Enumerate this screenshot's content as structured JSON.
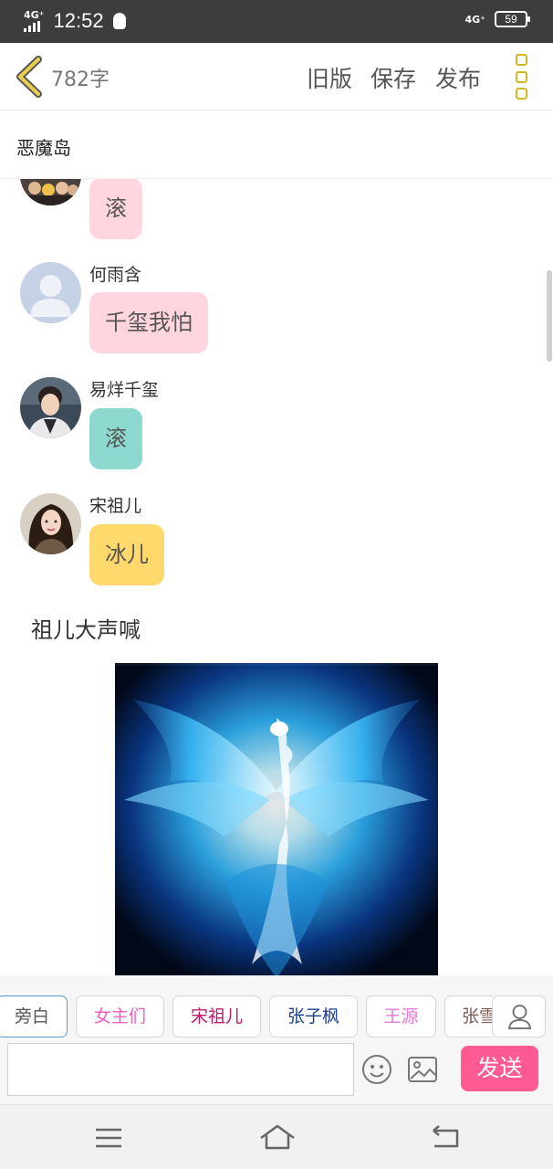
{
  "status_bar": {
    "network_left": "4G⁺",
    "time": "12:52",
    "network_right": "4G⁺",
    "battery": "59"
  },
  "header": {
    "word_count": "782字",
    "old_version": "旧版",
    "save": "保存",
    "publish": "发布"
  },
  "story_title": "恶魔岛",
  "messages": [
    {
      "name": "",
      "text": "滚",
      "bubble_color": "#ffd6e0"
    },
    {
      "name": "何雨含",
      "text": "千玺我怕",
      "bubble_color": "#ffd6e0"
    },
    {
      "name": "易烊千玺",
      "text": "滚",
      "bubble_color": "#8ed9cf"
    },
    {
      "name": "宋祖儿",
      "text": "冰儿",
      "bubble_color": "#ffd96b"
    }
  ],
  "narration": "祖儿大声喊",
  "image_icon": "blue-phoenix-image",
  "character_chips": [
    {
      "label": "旁白",
      "color": "#555555"
    },
    {
      "label": "女主们",
      "color": "#f05fc0"
    },
    {
      "label": "宋祖儿",
      "color": "#c0196b"
    },
    {
      "label": "张子枫",
      "color": "#1a3f8c"
    },
    {
      "label": "王源",
      "color": "#e27ad6"
    },
    {
      "label": "张雪",
      "color": "#7a5a52"
    }
  ],
  "input": {
    "value": "",
    "placeholder": ""
  },
  "send_label": "发送",
  "colors": {
    "accent_pink": "#ff5a93",
    "menu_yellow": "#d2b62a"
  }
}
